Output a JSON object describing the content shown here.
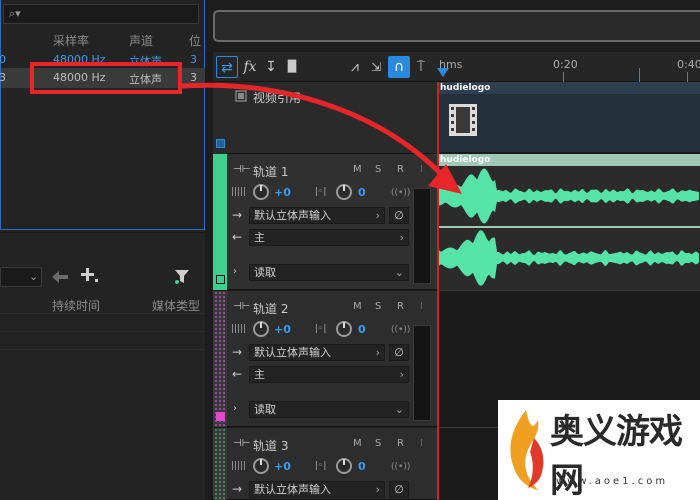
{
  "files_panel": {
    "search_icon": "⌕▾",
    "columns": {
      "sample_rate": "采样率",
      "channels": "声道",
      "bits": "位"
    },
    "rows": [
      {
        "lead": "0",
        "sample_rate": "48000 Hz",
        "channels": "立体声",
        "bits": "3",
        "selected": false
      },
      {
        "lead": "3",
        "sample_rate": "48000 Hz",
        "channels": "立体声",
        "bits": "3",
        "selected": true
      }
    ]
  },
  "markers_panel": {
    "select_chevron": "⌄",
    "columns": {
      "duration": "持续时间",
      "media_type": "媒体类型"
    }
  },
  "toolbar": {
    "swap_icon": "⇄",
    "fx_label": "fx",
    "stack_icon": "↧",
    "meter_icon": "▐▌",
    "metronome_icon": "⩘",
    "magnet_icon": "∩",
    "pin_icon": "⍑"
  },
  "ruler": {
    "unit": "hms",
    "marks": [
      "0:20",
      "0:40"
    ]
  },
  "video_track": {
    "name": "视频引用",
    "clip_name": "hudielogo"
  },
  "tracks": [
    {
      "name": "轨道 1",
      "volume": "+0",
      "pan": "0",
      "input": "默认立体声输入",
      "output": "主",
      "automation": "读取",
      "color": "#3fcf8e",
      "clip_name": "hudielogo"
    },
    {
      "name": "轨道 2",
      "volume": "+0",
      "pan": "0",
      "input": "默认立体声输入",
      "output": "主",
      "automation": "读取",
      "color": "#b04fb8"
    },
    {
      "name": "轨道 3",
      "volume": "+0",
      "pan": "0",
      "input": "默认立体声输入",
      "color": "#3f9e5e"
    }
  ],
  "track_buttons": {
    "mute": "M",
    "solo": "S",
    "record": "R",
    "input_monitor": "I",
    "stereo": "((•))",
    "no_input": "∅",
    "level": "|||||"
  },
  "watermark": {
    "title": "奥义游戏网",
    "url": "www.aoe1.com"
  },
  "colors": {
    "accent": "#2a8ae0",
    "annotation": "#e8262a",
    "waveform": "#56e3a8"
  }
}
